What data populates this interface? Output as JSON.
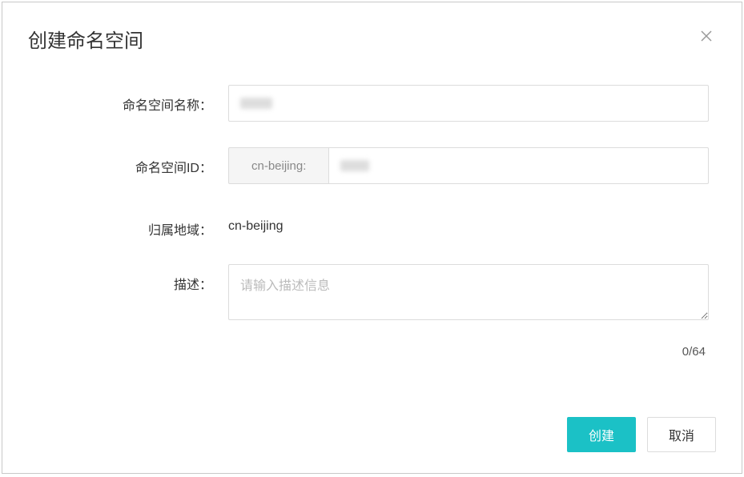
{
  "dialog": {
    "title": "创建命名空间",
    "form": {
      "name": {
        "label": "命名空间名称：",
        "value": ""
      },
      "id": {
        "label": "命名空间ID：",
        "prefix": "cn-beijing:",
        "value": ""
      },
      "region": {
        "label": "归属地域：",
        "value": "cn-beijing"
      },
      "description": {
        "label": "描述：",
        "placeholder": "请输入描述信息",
        "value": "",
        "counter": "0/64"
      }
    },
    "footer": {
      "create": "创建",
      "cancel": "取消"
    }
  }
}
